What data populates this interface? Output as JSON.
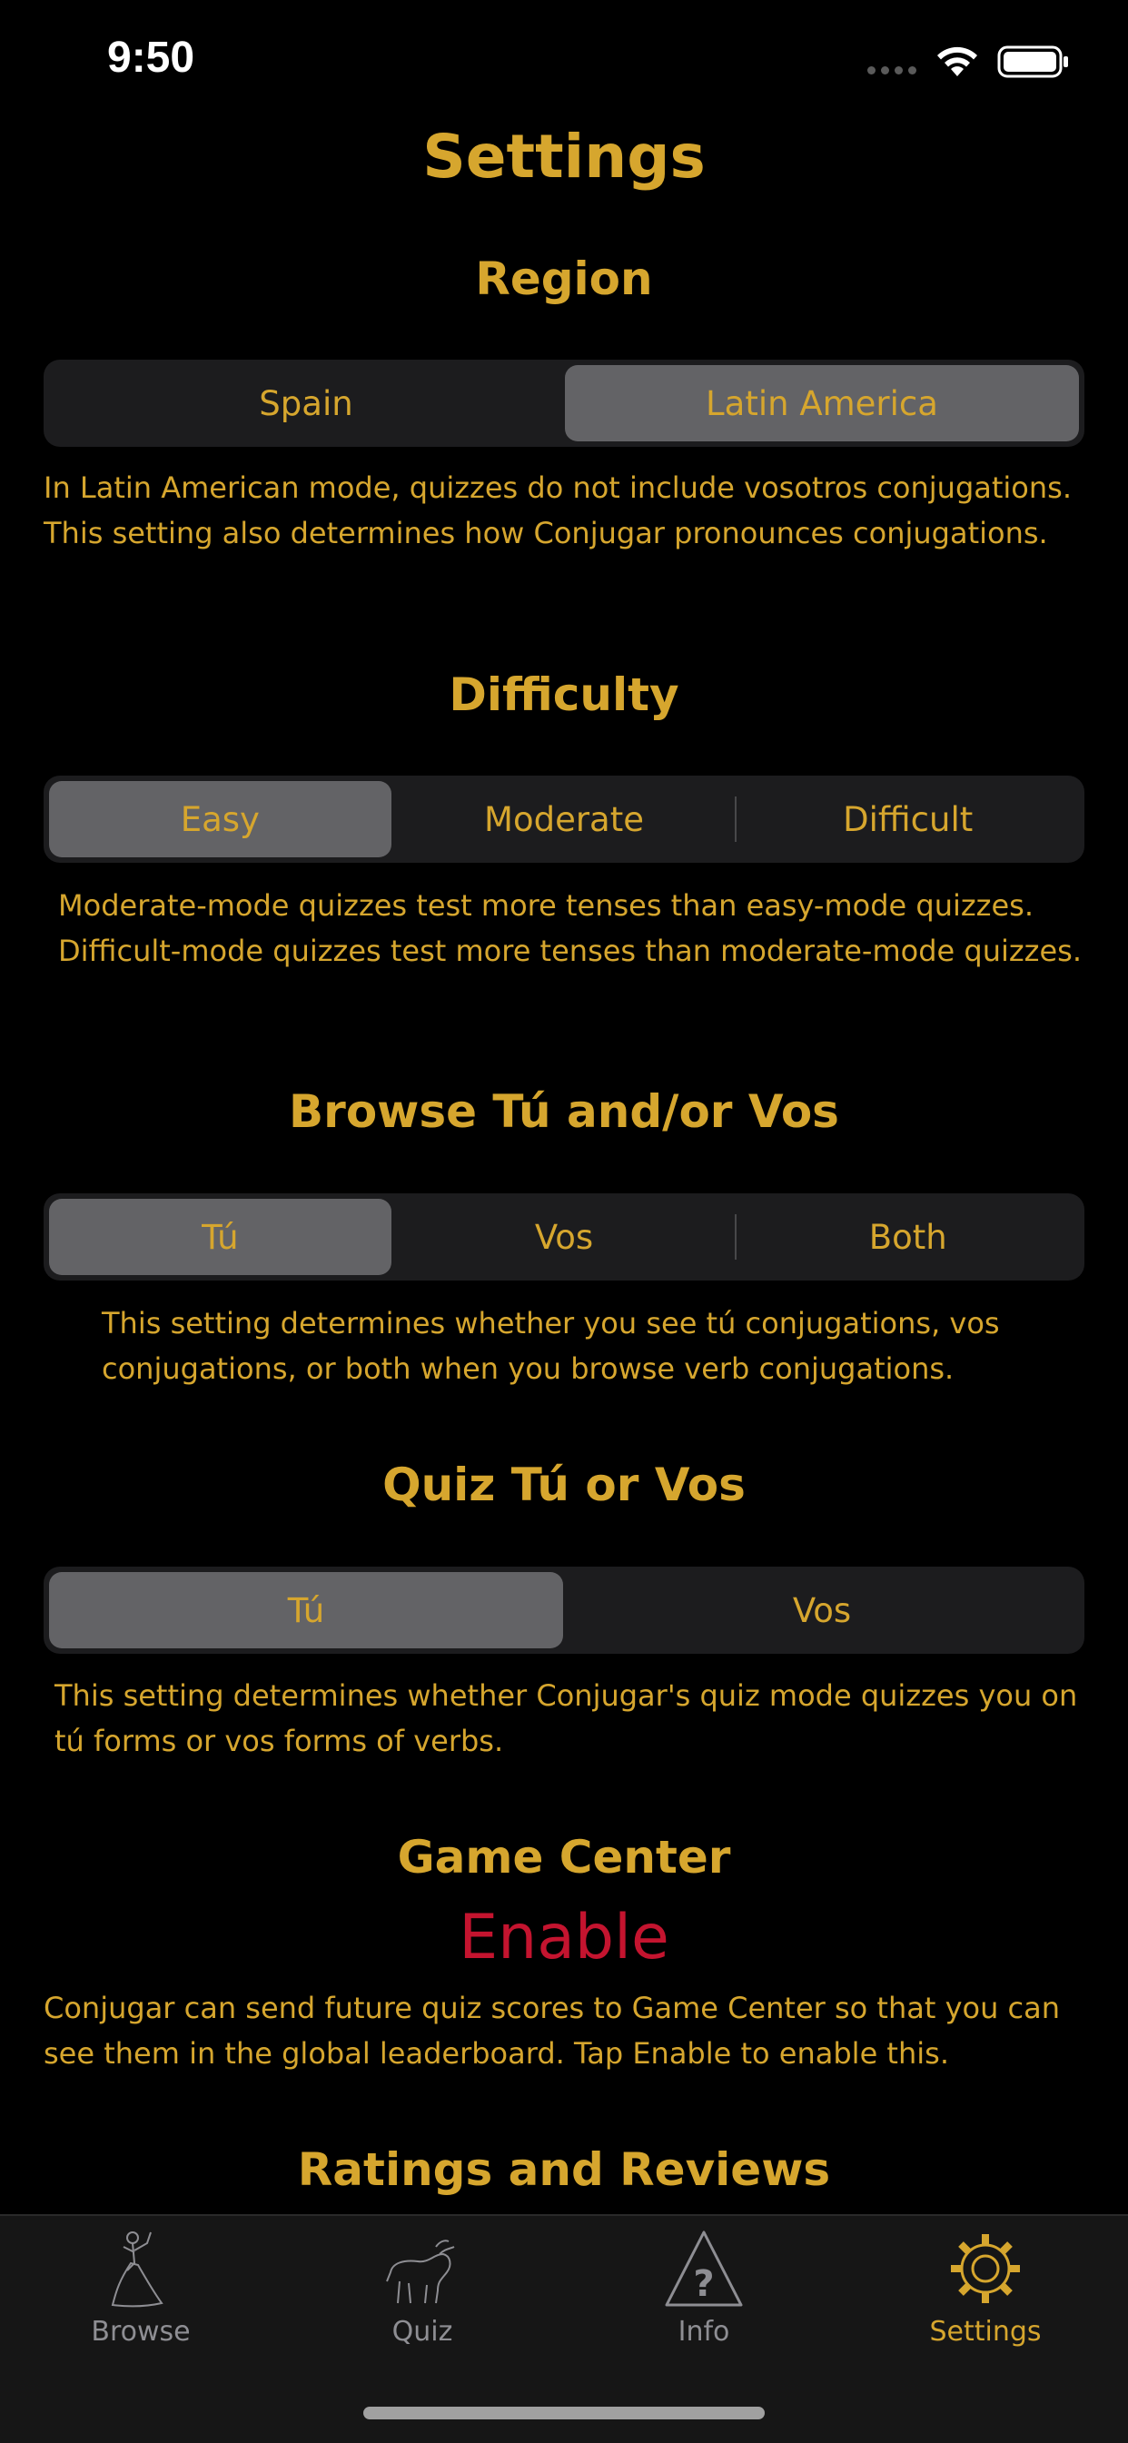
{
  "status_bar": {
    "time": "9:50"
  },
  "page": {
    "title": "Settings"
  },
  "region": {
    "heading": "Region",
    "options": [
      "Spain",
      "Latin America"
    ],
    "selected": 1,
    "description": "In Latin American mode, quizzes do not include vosotros conjugations. This setting also determines how Conjugar pronounces conjugations."
  },
  "difficulty": {
    "heading": "Difficulty",
    "options": [
      "Easy",
      "Moderate",
      "Difficult"
    ],
    "selected": 0,
    "description": "Moderate-mode quizzes test more tenses than easy-mode quizzes. Difficult-mode quizzes test more tenses than moderate-mode quizzes."
  },
  "browse_tu_vos": {
    "heading": "Browse Tú and/or Vos",
    "options": [
      "Tú",
      "Vos",
      "Both"
    ],
    "selected": 0,
    "description": "This setting determines whether you see tú conjugations, vos conjugations, or both when you browse verb conjugations."
  },
  "quiz_tu_vos": {
    "heading": "Quiz Tú or Vos",
    "options": [
      "Tú",
      "Vos"
    ],
    "selected": 0,
    "description": "This setting determines whether Conjugar's quiz mode quizzes you on tú forms or vos forms of verbs."
  },
  "game_center": {
    "heading": "Game Center",
    "enable_label": "Enable",
    "description": "Conjugar can send future quiz scores to Game Center so that you can see them in the global leaderboard. Tap Enable to enable this."
  },
  "ratings": {
    "heading": "Ratings and Reviews"
  },
  "tab_bar": {
    "tabs": [
      {
        "label": "Browse",
        "icon": "dancer-icon"
      },
      {
        "label": "Quiz",
        "icon": "bull-icon"
      },
      {
        "label": "Info",
        "icon": "question-triangle-icon"
      },
      {
        "label": "Settings",
        "icon": "gear-icon"
      }
    ],
    "selected": 3
  },
  "colors": {
    "background": "#000000",
    "accent": "#d6a62e",
    "segment_bg": "#1c1c1e",
    "segment_selected": "#636366",
    "enable": "#c4142f",
    "tab_inactive": "#8e8e93"
  }
}
